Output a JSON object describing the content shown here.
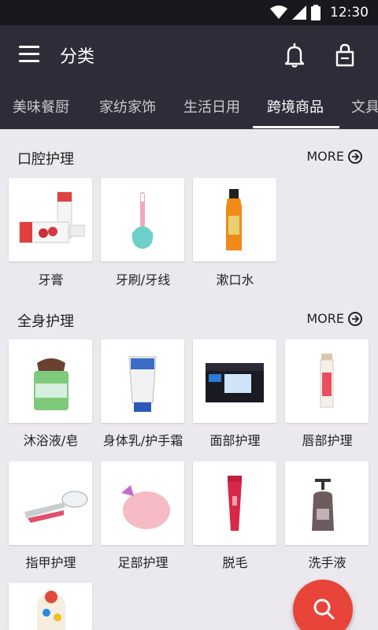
{
  "status_bar": {
    "time": "12:30"
  },
  "header": {
    "title": "分类"
  },
  "tabs": [
    {
      "label": "美味餐厨"
    },
    {
      "label": "家纺家饰"
    },
    {
      "label": "生活日用"
    },
    {
      "label": "跨境商品",
      "active": true
    },
    {
      "label": "文具"
    }
  ],
  "sections": [
    {
      "title": "口腔护理",
      "more": "MORE",
      "items": [
        {
          "label": "牙膏",
          "icon": "toothpaste-icon"
        },
        {
          "label": "牙刷/牙线",
          "icon": "toothbrush-icon"
        },
        {
          "label": "漱口水",
          "icon": "mouthwash-icon"
        }
      ]
    },
    {
      "title": "全身护理",
      "more": "MORE",
      "items": [
        {
          "label": "沐浴液/皂",
          "icon": "soap-icon"
        },
        {
          "label": "身体乳/护手霜",
          "icon": "hand-cream-icon"
        },
        {
          "label": "面部护理",
          "icon": "cotton-pads-icon"
        },
        {
          "label": "唇部护理",
          "icon": "lip-balm-icon"
        },
        {
          "label": "指甲护理",
          "icon": "nail-clipper-icon"
        },
        {
          "label": "足部护理",
          "icon": "foot-sponge-icon"
        },
        {
          "label": "脱毛",
          "icon": "epilator-icon"
        },
        {
          "label": "洗手液",
          "icon": "hand-soap-pump-icon"
        }
      ]
    }
  ],
  "colors": {
    "app_bar": "#2d2d3a",
    "status_bar": "#18181f",
    "background": "#ebe9ed",
    "fab": "#e8443a"
  }
}
